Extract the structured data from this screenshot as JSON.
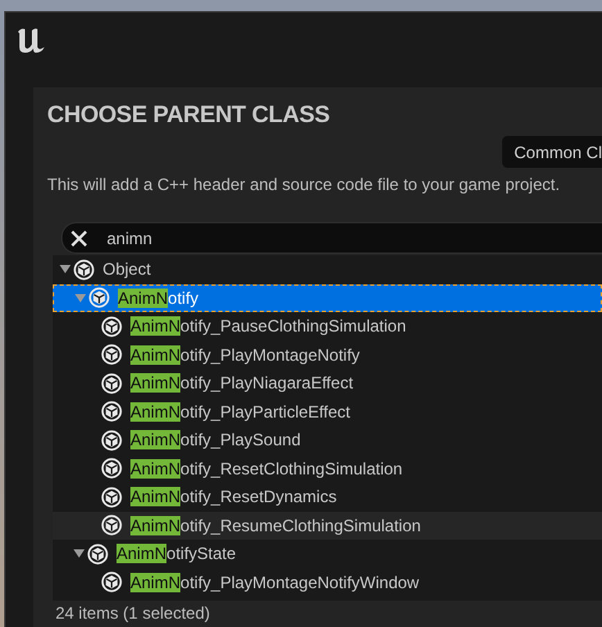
{
  "dialog": {
    "title": "CHOOSE PARENT CLASS",
    "tab_button": "Common Cl",
    "description": "This will add a C++ header and source code file to your game project."
  },
  "search": {
    "value": "animn"
  },
  "tree": [
    {
      "rest": "Object",
      "expanded": true,
      "selected": false,
      "hovered": false,
      "children": [
        {
          "match": "AnimN",
          "rest": "otify",
          "expanded": true,
          "selected": true,
          "hovered": false,
          "children": [
            {
              "match": "AnimN",
              "rest": "otify_PauseClothingSimulation",
              "selected": false,
              "hovered": false
            },
            {
              "match": "AnimN",
              "rest": "otify_PlayMontageNotify",
              "selected": false,
              "hovered": false
            },
            {
              "match": "AnimN",
              "rest": "otify_PlayNiagaraEffect",
              "selected": false,
              "hovered": false
            },
            {
              "match": "AnimN",
              "rest": "otify_PlayParticleEffect",
              "selected": false,
              "hovered": false
            },
            {
              "match": "AnimN",
              "rest": "otify_PlaySound",
              "selected": false,
              "hovered": false
            },
            {
              "match": "AnimN",
              "rest": "otify_ResetClothingSimulation",
              "selected": false,
              "hovered": false
            },
            {
              "match": "AnimN",
              "rest": "otify_ResetDynamics",
              "selected": false,
              "hovered": false
            },
            {
              "match": "AnimN",
              "rest": "otify_ResumeClothingSimulation",
              "selected": false,
              "hovered": true
            }
          ]
        },
        {
          "match": "AnimN",
          "rest": "otifyState",
          "expanded": true,
          "selected": false,
          "hovered": false,
          "children": [
            {
              "match": "AnimN",
              "rest": "otify_PlayMontageNotifyWindow",
              "selected": false,
              "hovered": false
            }
          ]
        }
      ]
    }
  ],
  "status_bar": "24 items (1 selected)"
}
